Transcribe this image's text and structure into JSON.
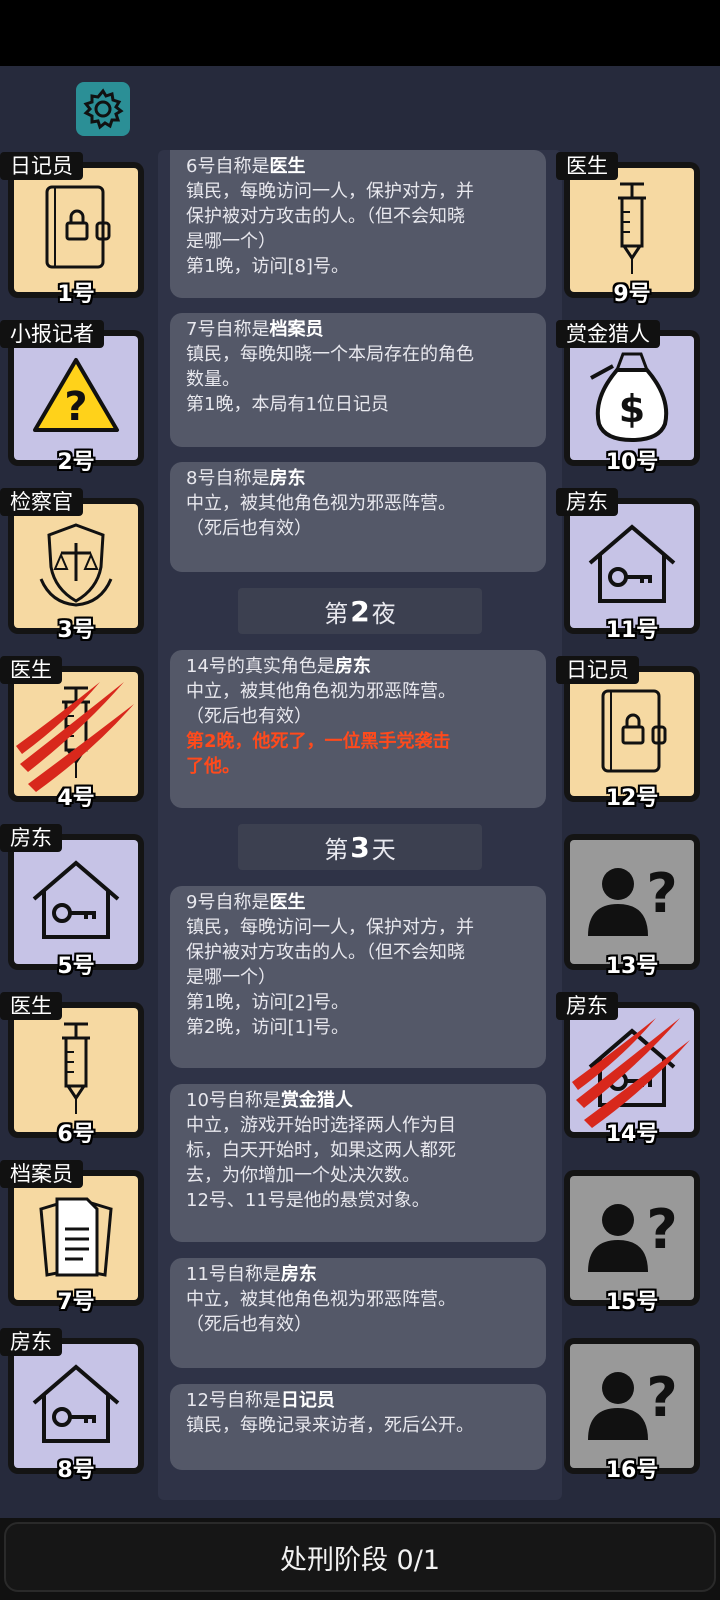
{
  "settings_icon": "gear-icon",
  "players_left": [
    {
      "role": "日记员",
      "num": "1号",
      "icon": "diary-icon",
      "bg": "beige",
      "killed": false
    },
    {
      "role": "小报记者",
      "num": "2号",
      "icon": "warning-icon",
      "bg": "lav",
      "killed": false
    },
    {
      "role": "检察官",
      "num": "3号",
      "icon": "prosecutor-badge-icon",
      "bg": "beige",
      "killed": false
    },
    {
      "role": "医生",
      "num": "4号",
      "icon": "syringe-icon",
      "bg": "beige",
      "killed": true
    },
    {
      "role": "房东",
      "num": "5号",
      "icon": "house-key-icon",
      "bg": "lav",
      "killed": false
    },
    {
      "role": "医生",
      "num": "6号",
      "icon": "syringe-icon",
      "bg": "beige",
      "killed": false
    },
    {
      "role": "档案员",
      "num": "7号",
      "icon": "documents-icon",
      "bg": "beige",
      "killed": false
    },
    {
      "role": "房东",
      "num": "8号",
      "icon": "house-key-icon",
      "bg": "lav",
      "killed": false
    }
  ],
  "players_right": [
    {
      "role": "医生",
      "num": "9号",
      "icon": "syringe-icon",
      "bg": "beige",
      "killed": false
    },
    {
      "role": "赏金猎人",
      "num": "10号",
      "icon": "money-bag-icon",
      "bg": "lav",
      "killed": false
    },
    {
      "role": "房东",
      "num": "11号",
      "icon": "house-key-icon",
      "bg": "lav",
      "killed": false
    },
    {
      "role": "日记员",
      "num": "12号",
      "icon": "diary-icon",
      "bg": "beige",
      "killed": false
    },
    {
      "role": "",
      "num": "13号",
      "icon": "unknown-person-icon",
      "bg": "gray",
      "killed": false
    },
    {
      "role": "房东",
      "num": "14号",
      "icon": "house-key-icon",
      "bg": "lav",
      "killed": true
    },
    {
      "role": "",
      "num": "15号",
      "icon": "unknown-person-icon",
      "bg": "gray",
      "killed": false
    },
    {
      "role": "",
      "num": "16号",
      "icon": "unknown-person-icon",
      "bg": "gray",
      "killed": false
    }
  ],
  "log": [
    {
      "type": "msg",
      "prefix": "6号自称是",
      "role": "医生",
      "lines": [
        "镇民，每晚访问一人，保护对方，并",
        "保护被对方攻击的人。（但不会知晓",
        "是哪一个）",
        "第1晚，访问[8]号。"
      ]
    },
    {
      "type": "msg",
      "prefix": "7号自称是",
      "role": "档案员",
      "lines": [
        "镇民，每晚知晓一个本局存在的角色",
        "数量。",
        "第1晚，本局有1位日记员"
      ]
    },
    {
      "type": "msg",
      "prefix": "8号自称是",
      "role": "房东",
      "lines": [
        "中立，被其他角色视为邪恶阵营。",
        "（死后也有效）"
      ]
    },
    {
      "type": "banner",
      "pre": "第",
      "num": "2",
      "post": "夜"
    },
    {
      "type": "msg",
      "prefix": "14号的真实角色是",
      "role": "房东",
      "lines": [
        "中立，被其他角色视为邪恶阵营。",
        "（死后也有效）"
      ],
      "red": [
        "第2晚，他死了，一位黑手党袭击",
        "了他。"
      ]
    },
    {
      "type": "banner",
      "pre": "第",
      "num": "3",
      "post": "天"
    },
    {
      "type": "msg",
      "prefix": "9号自称是",
      "role": "医生",
      "lines": [
        "镇民，每晚访问一人，保护对方，并",
        "保护被对方攻击的人。（但不会知晓",
        "是哪一个）",
        "第1晚，访问[2]号。",
        "第2晚，访问[1]号。"
      ]
    },
    {
      "type": "msg",
      "prefix": "10号自称是",
      "role": "赏金猎人",
      "lines": [
        "中立，游戏开始时选择两人作为目",
        "标，白天开始时，如果这两人都死",
        "去，为你增加一个处决次数。",
        "12号、11号是他的悬赏对象。"
      ]
    },
    {
      "type": "msg",
      "prefix": "11号自称是",
      "role": "房东",
      "lines": [
        "中立，被其他角色视为邪恶阵营。",
        "（死后也有效）"
      ]
    },
    {
      "type": "msg",
      "prefix": "12号自称是",
      "role": "日记员",
      "lines": [
        "镇民，每晚记录来访者，死后公开。"
      ]
    }
  ],
  "bottom_button": "处刑阶段 0/1",
  "colors": {
    "red_text": "#ff4a1c",
    "settings_bg": "#2b8f96",
    "beige": "#f6d9a2",
    "lavender": "#c6c3e6",
    "unknown": "#999999"
  }
}
